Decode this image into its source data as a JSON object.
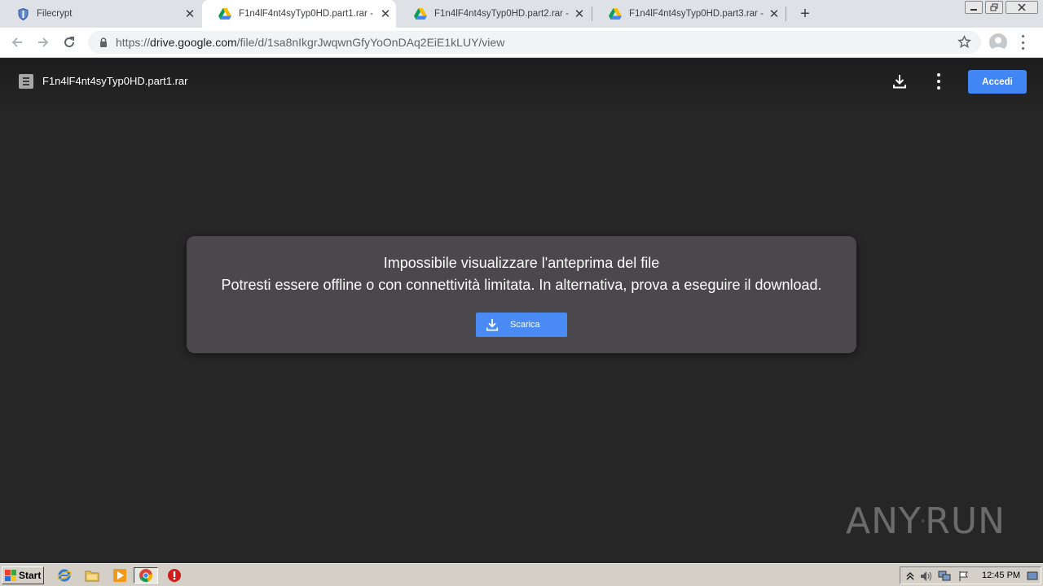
{
  "tabs": [
    {
      "title": "Filecrypt",
      "favicon": "shield-icon",
      "active": false
    },
    {
      "title": "F1n4lF4nt4syTyp0HD.part1.rar - Go",
      "favicon": "google-drive-icon",
      "active": true
    },
    {
      "title": "F1n4lF4nt4syTyp0HD.part2.rar - Go",
      "favicon": "google-drive-icon",
      "active": false
    },
    {
      "title": "F1n4lF4nt4syTyp0HD.part3.rar - Go",
      "favicon": "google-drive-icon",
      "active": false
    }
  ],
  "toolbar": {
    "url_scheme": "https://",
    "url_host": "drive.google.com",
    "url_path": "/file/d/1sa8nIkgrJwqwnGfyYoOnDAq2EiE1kLUY/view"
  },
  "viewer": {
    "file_name": "F1n4lF4nt4syTyp0HD.part1.rar",
    "signin_label": "Accedi"
  },
  "dialog": {
    "title": "Impossibile visualizzare l'anteprima del file",
    "message": "Potresti essere offline o con connettività limitata. In alternativa, prova a eseguire il download.",
    "button_label": "Scarica"
  },
  "watermark": {
    "left": "ANY",
    "right": "RUN"
  },
  "taskbar": {
    "start_label": "Start",
    "clock": "12:45 PM"
  },
  "colors": {
    "accent_blue": "#4285f4",
    "viewer_bg": "#262626",
    "dialog_bg": "#4a484a"
  }
}
